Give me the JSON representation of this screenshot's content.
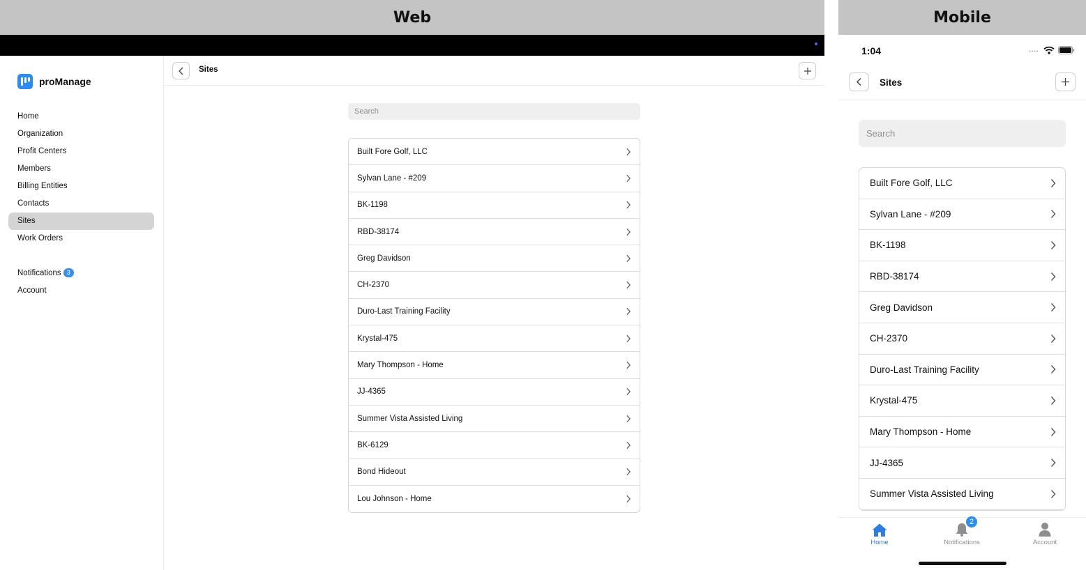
{
  "sections": {
    "web_label": "Web",
    "mobile_label": "Mobile"
  },
  "web": {
    "brand": {
      "name": "proManage",
      "logo_icon": "promanage-logo-icon"
    },
    "nav": [
      {
        "label": "Home",
        "active": false
      },
      {
        "label": "Organization",
        "active": false
      },
      {
        "label": "Profit Centers",
        "active": false
      },
      {
        "label": "Members",
        "active": false
      },
      {
        "label": "Billing Entities",
        "active": false
      },
      {
        "label": "Contacts",
        "active": false
      },
      {
        "label": "Sites",
        "active": true
      },
      {
        "label": "Work Orders",
        "active": false
      }
    ],
    "nav_lower": {
      "notifications": {
        "label": "Notifications",
        "badge": "3"
      },
      "account": {
        "label": "Account"
      }
    },
    "header": {
      "title": "Sites",
      "back_icon": "chevron-left-icon",
      "add_icon": "plus-icon"
    },
    "search": {
      "placeholder": "Search",
      "value": ""
    },
    "sites": [
      "Built Fore Golf, LLC",
      "Sylvan Lane - #209",
      "BK-1198",
      "RBD-38174",
      "Greg Davidson",
      "CH-2370",
      "Duro-Last Training Facility",
      "Krystal-475",
      "Mary Thompson - Home",
      "JJ-4365",
      "Summer Vista Assisted Living",
      "BK-6129",
      "Bond Hideout",
      "Lou Johnson - Home"
    ]
  },
  "mobile": {
    "status": {
      "time": "1:04",
      "signal_icon": "cellular-signal-icon",
      "wifi_icon": "wifi-icon",
      "battery_icon": "battery-icon"
    },
    "header": {
      "title": "Sites",
      "back_icon": "chevron-left-icon",
      "add_icon": "plus-icon"
    },
    "search": {
      "placeholder": "Search",
      "value": ""
    },
    "sites": [
      "Built Fore Golf, LLC",
      "Sylvan Lane - #209",
      "BK-1198",
      "RBD-38174",
      "Greg Davidson",
      "CH-2370",
      "Duro-Last Training Facility",
      "Krystal-475",
      "Mary Thompson - Home",
      "JJ-4365",
      "Summer Vista Assisted Living"
    ],
    "tabs": [
      {
        "label": "Home",
        "icon": "house-icon",
        "active": true
      },
      {
        "label": "Notifications",
        "icon": "bell-icon",
        "badge": "2",
        "active": false
      },
      {
        "label": "Account",
        "icon": "person-icon",
        "active": false
      }
    ]
  },
  "colors": {
    "accent": "#2d8cf0",
    "active_nav_bg": "#d4d4d4",
    "section_header_bg": "#c4c4c4",
    "topbar_bg": "#000000"
  }
}
